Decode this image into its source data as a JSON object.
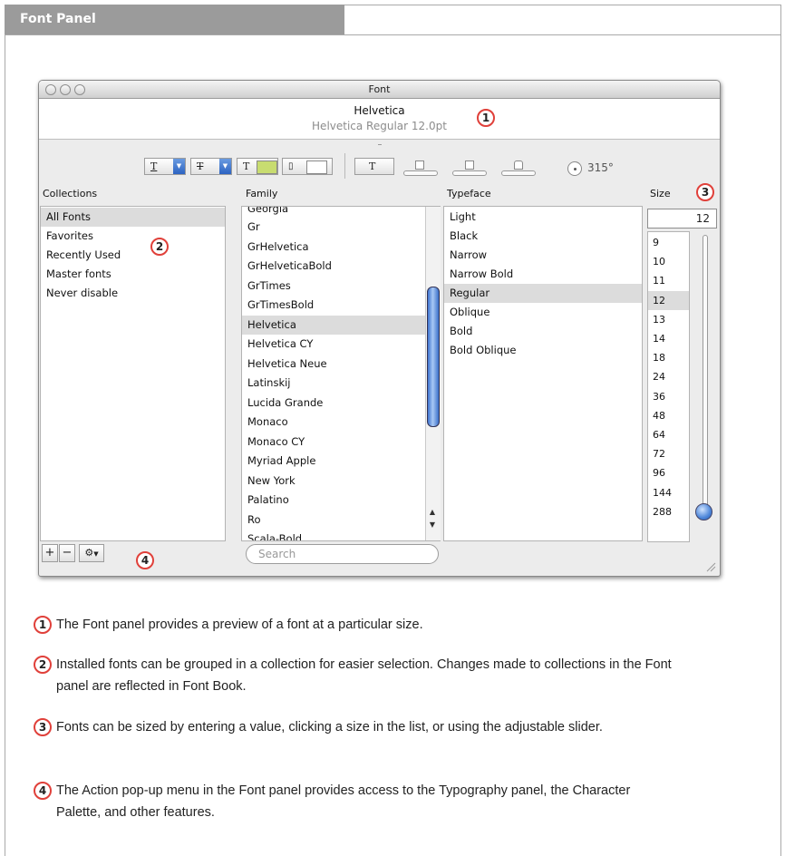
{
  "header": {
    "title": "Font Panel"
  },
  "window": {
    "title": "Font",
    "preview": {
      "font_name": "Helvetica",
      "detail": "Helvetica Regular 12.0pt"
    },
    "toolbar": {
      "angle": "315°"
    },
    "columns": {
      "collections": "Collections",
      "family": "Family",
      "typeface": "Typeface",
      "size": "Size"
    },
    "collections": [
      "All Fonts",
      "Favorites",
      "Recently Used",
      "Master fonts",
      "Never disable"
    ],
    "families": [
      "Georgia",
      "Gr",
      "GrHelvetica",
      "GrHelveticaBold",
      "GrTimes",
      "GrTimesBold",
      "Helvetica",
      "Helvetica CY",
      "Helvetica Neue",
      "Latinskij",
      "Lucida Grande",
      "Monaco",
      "Monaco CY",
      "Myriad Apple",
      "New York",
      "Palatino",
      "Ro",
      "Scala-Bold"
    ],
    "typefaces": [
      "Light",
      "Black",
      "Narrow",
      "Narrow Bold",
      "Regular",
      "Oblique",
      "Bold",
      "Bold Oblique"
    ],
    "size_value": "12",
    "sizes": [
      "9",
      "10",
      "11",
      "12",
      "13",
      "14",
      "18",
      "24",
      "36",
      "48",
      "64",
      "72",
      "96",
      "144",
      "288"
    ],
    "search_placeholder": "Search",
    "add_label": "+",
    "remove_label": "−"
  },
  "callouts": [
    "1",
    "2",
    "3",
    "4"
  ],
  "notes": [
    "The Font panel provides a preview of a font at a particular size.",
    "Installed fonts can be grouped in a collection for easier selection. Changes made to collections in the Font panel are reflected in Font Book.",
    "Fonts can be sized by entering a value, clicking a size in the list, or using the adjustable slider.",
    "The Action pop-up menu in the Font panel provides access to the Typography panel, the Character Palette, and other features."
  ]
}
